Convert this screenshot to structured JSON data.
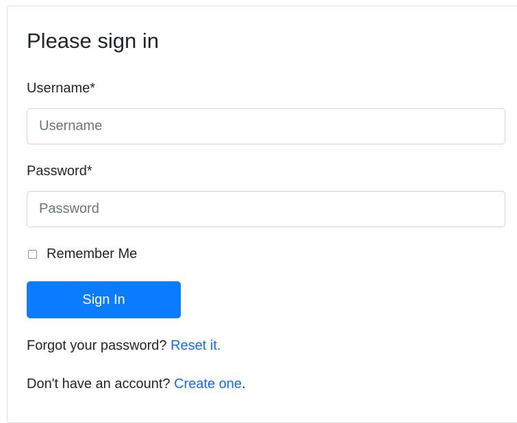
{
  "form": {
    "title": "Please sign in",
    "username": {
      "label": "Username*",
      "placeholder": "Username",
      "value": ""
    },
    "password": {
      "label": "Password*",
      "placeholder": "Password",
      "value": ""
    },
    "remember_me": {
      "label": "Remember Me",
      "checked": false
    },
    "submit_label": "Sign In",
    "forgot": {
      "text": "Forgot your password?",
      "link_label": "Reset it."
    },
    "signup": {
      "text": "Don't have an account?",
      "link_label": "Create one",
      "suffix": "."
    }
  },
  "colors": {
    "primary": "#0b7bff",
    "link": "#0d6efd",
    "text": "#212529",
    "border": "#ced4da"
  }
}
